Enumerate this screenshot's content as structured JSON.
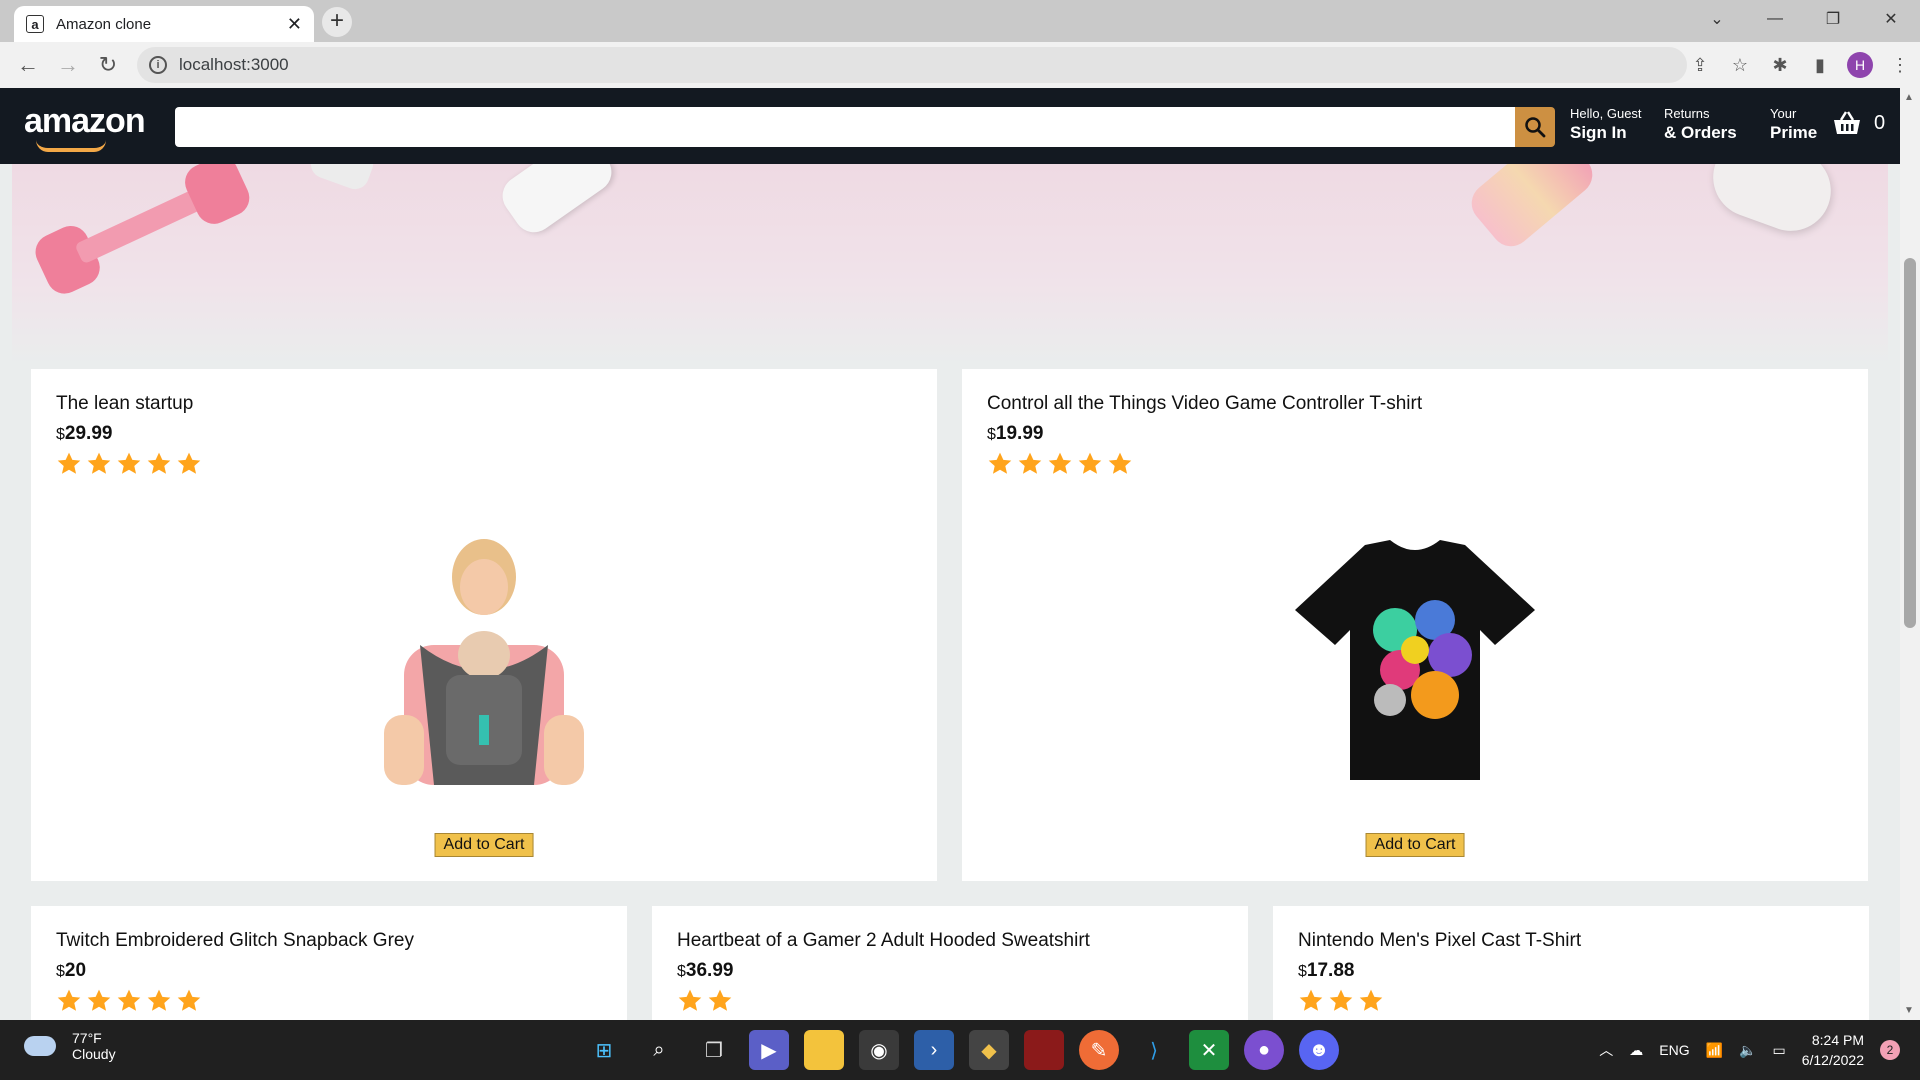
{
  "browser": {
    "tab_title": "Amazon clone",
    "favicon_letter": "a",
    "url": "localhost:3000",
    "profile_initial": "H"
  },
  "header": {
    "logo_text": "amazon",
    "search_placeholder": "",
    "greeting": "Hello, Guest",
    "sign_in": "Sign In",
    "returns_l1": "Returns",
    "returns_l2": "& Orders",
    "prime_l1": "Your",
    "prime_l2": "Prime",
    "basket_count": "0"
  },
  "products_row1": [
    {
      "title": "The lean startup",
      "currency": "$",
      "price": "29.99",
      "rating": 5,
      "button": "Add to Cart",
      "image": "baby-carrier"
    },
    {
      "title": "Control all the Things Video Game Controller T-shirt",
      "currency": "$",
      "price": "19.99",
      "rating": 5,
      "button": "Add to Cart",
      "image": "game-controller-tshirt"
    }
  ],
  "products_row2": [
    {
      "title": "Twitch Embroidered Glitch Snapback Grey",
      "currency": "$",
      "price": "20",
      "rating": 5
    },
    {
      "title": "Heartbeat of a Gamer 2 Adult Hooded Sweatshirt",
      "currency": "$",
      "price": "36.99",
      "rating": 2
    },
    {
      "title": "Nintendo Men's Pixel Cast T-Shirt",
      "currency": "$",
      "price": "17.88",
      "rating": 3
    }
  ],
  "taskbar": {
    "temperature": "77°F",
    "condition": "Cloudy",
    "language": "ENG",
    "time": "8:24 PM",
    "date": "6/12/2022",
    "notifications": "2"
  },
  "colors": {
    "amazon_dark": "#131921",
    "search_button": "#cd9042",
    "star": "#ffa41c",
    "button": "#f0c14b"
  }
}
